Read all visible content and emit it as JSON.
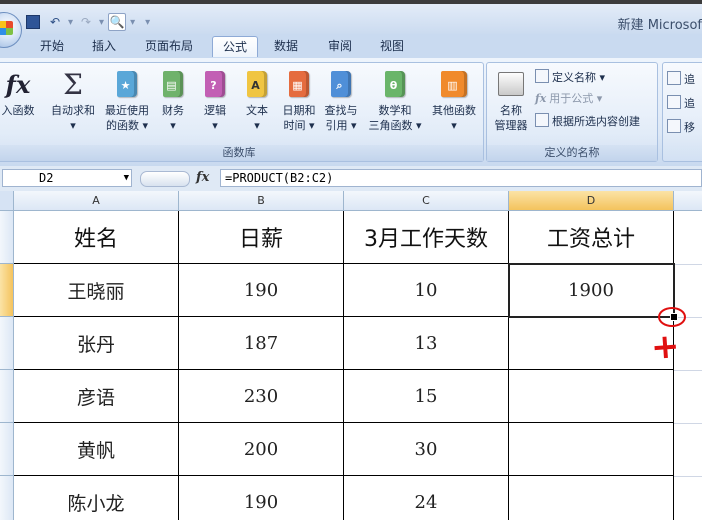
{
  "window": {
    "title": "新建 Microsof"
  },
  "tabs": [
    "开始",
    "插入",
    "页面布局",
    "公式",
    "数据",
    "审阅",
    "视图"
  ],
  "active_tab": "公式",
  "ribbon": {
    "function_library": {
      "label": "函数库",
      "buttons": [
        {
          "line1": "入函数",
          "line2": "",
          "icon": "fx-icon"
        },
        {
          "line1": "自动求和",
          "line2": "▾",
          "icon": "sigma-icon"
        },
        {
          "line1": "最近使用",
          "line2": "的函数 ▾",
          "icon": "book-star-icon",
          "color": "#5aa7d8"
        },
        {
          "line1": "财务",
          "line2": "▾",
          "icon": "book-finance-icon",
          "color": "#6fb26b"
        },
        {
          "line1": "逻辑",
          "line2": "▾",
          "icon": "book-logic-icon",
          "color": "#c25fb4",
          "glyph": "?"
        },
        {
          "line1": "文本",
          "line2": "▾",
          "icon": "book-text-icon",
          "color": "#f0c542",
          "glyph": "A"
        },
        {
          "line1": "日期和",
          "line2": "时间 ▾",
          "icon": "book-date-icon",
          "color": "#e56c3f"
        },
        {
          "line1": "查找与",
          "line2": "引用 ▾",
          "icon": "book-lookup-icon",
          "color": "#4f8fd8"
        },
        {
          "line1": "数学和",
          "line2": "三角函数 ▾",
          "icon": "book-math-icon",
          "color": "#6ab56a",
          "glyph": "θ"
        },
        {
          "line1": "其他函数",
          "line2": "▾",
          "icon": "book-more-icon",
          "color": "#f08a2c"
        }
      ]
    },
    "defined_names": {
      "label": "定义的名称",
      "manager": {
        "line1": "名称",
        "line2": "管理器",
        "icon": "name-manager-icon"
      },
      "define_name": "定义名称 ▾",
      "use_in_formula": "用于公式 ▾",
      "create_from_selection": "根据所选内容创建"
    },
    "auditing": {
      "items": [
        "追",
        "追",
        "移"
      ]
    }
  },
  "formula_bar": {
    "name_box": "D2",
    "fx": "fx",
    "formula": "=PRODUCT(B2:C2)"
  },
  "columns": [
    "A",
    "B",
    "C",
    "D"
  ],
  "table": {
    "headers": [
      "姓名",
      "日薪",
      "3月工作天数",
      "工资总计"
    ],
    "rows": [
      [
        "王晓丽",
        "190",
        "10",
        "1900"
      ],
      [
        "张丹",
        "187",
        "13",
        ""
      ],
      [
        "彦语",
        "230",
        "15",
        ""
      ],
      [
        "黄帆",
        "200",
        "30",
        ""
      ],
      [
        "陈小龙",
        "190",
        "24",
        ""
      ]
    ]
  },
  "annotation": {
    "plus": "+",
    "color": "#e01010"
  }
}
